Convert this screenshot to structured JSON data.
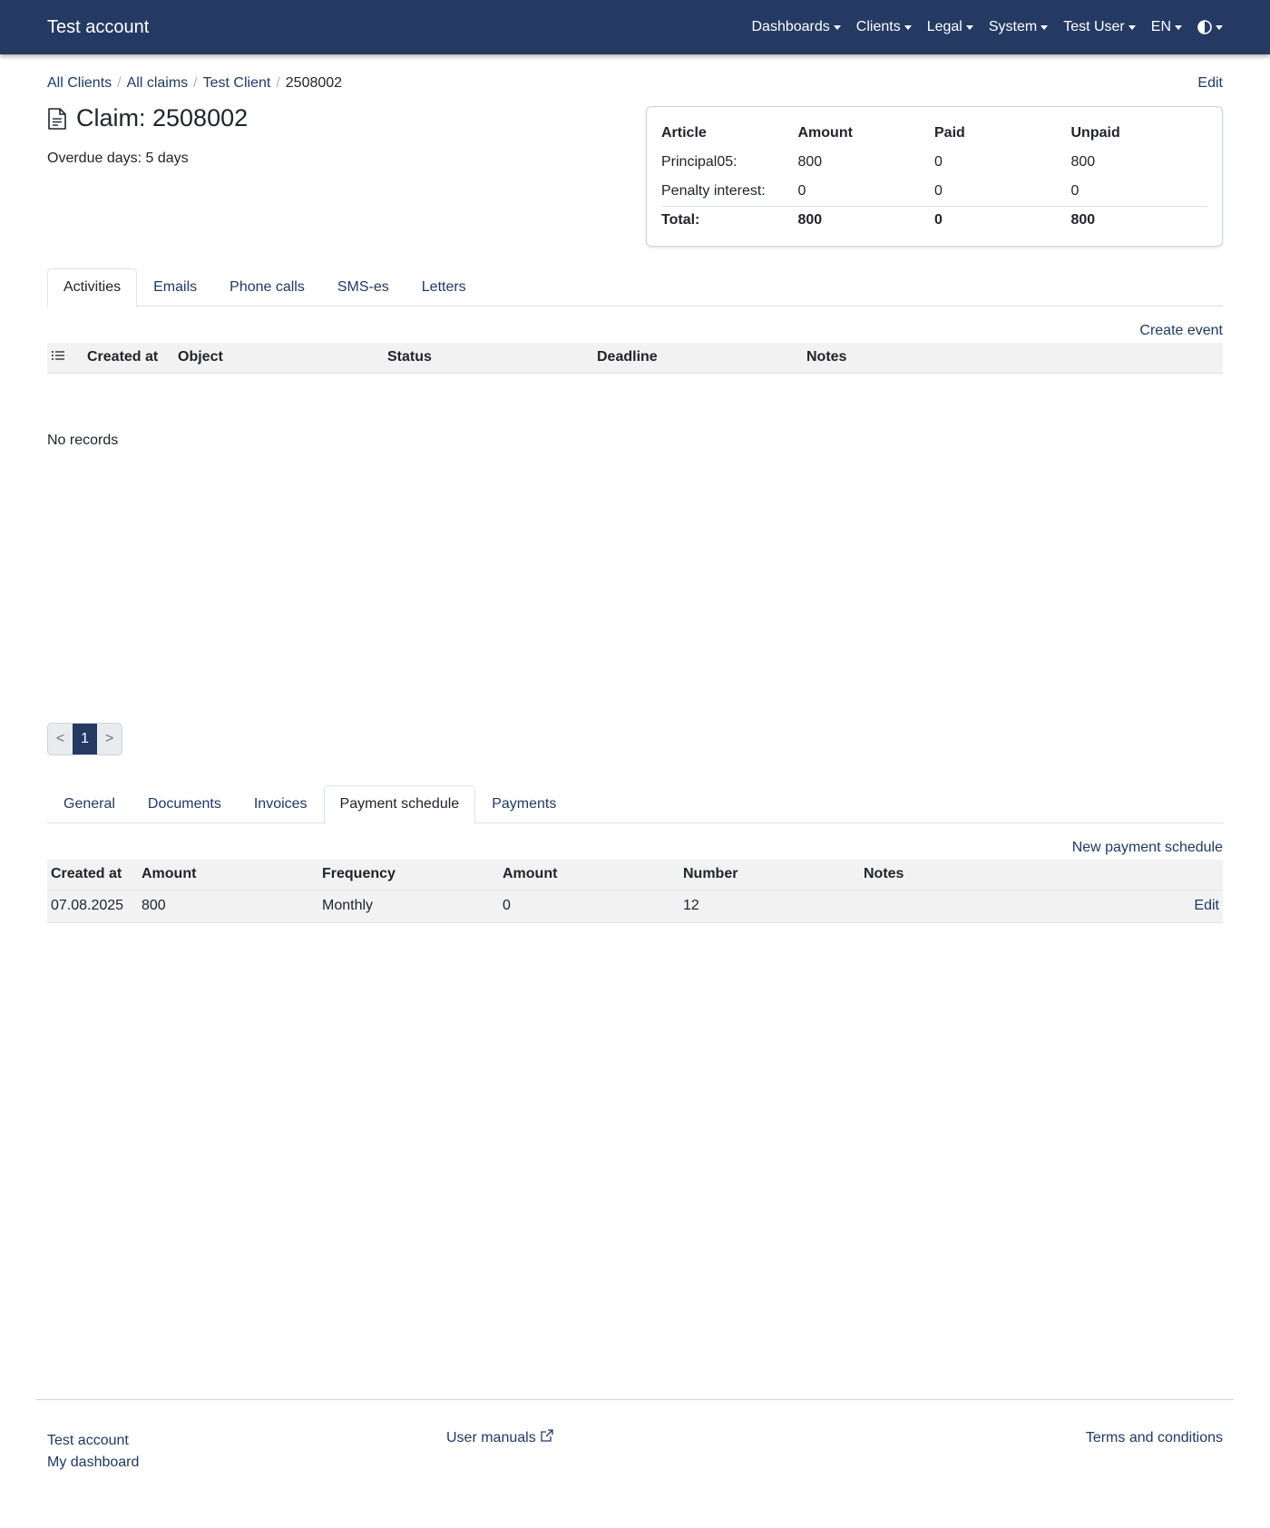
{
  "navbar": {
    "brand": "Test account",
    "items": [
      "Dashboards",
      "Clients",
      "Legal",
      "System",
      "Test User",
      "EN"
    ],
    "theme_icon": "half-circle-icon"
  },
  "breadcrumb": [
    "All Clients",
    "All claims",
    "Test Client",
    "2508002"
  ],
  "header": {
    "edit_label": "Edit",
    "title": "Claim: 2508002",
    "title_icon": "document-icon",
    "overdue": "Overdue days: 5 days"
  },
  "summary": {
    "headers": [
      "Article",
      "Amount",
      "Paid",
      "Unpaid"
    ],
    "rows": [
      [
        "Principal05:",
        "800",
        "0",
        "800"
      ],
      [
        "Penalty interest:",
        "0",
        "0",
        "0"
      ]
    ],
    "total": [
      "Total:",
      "800",
      "0",
      "800"
    ]
  },
  "activity_tabs": [
    "Activities",
    "Emails",
    "Phone calls",
    "SMS-es",
    "Letters"
  ],
  "activity_section": {
    "create_event": "Create event",
    "headers": [
      "Created at",
      "Object",
      "Status",
      "Deadline",
      "Notes"
    ],
    "list_icon": "list-icon",
    "empty": "No records"
  },
  "pagination": {
    "prev": "<",
    "page": "1",
    "next": ">"
  },
  "detail_tabs": [
    "General",
    "Documents",
    "Invoices",
    "Payment schedule",
    "Payments"
  ],
  "schedule": {
    "new_label": "New payment schedule",
    "headers": [
      "Created at",
      "Amount",
      "Frequency",
      "Amount",
      "Number",
      "Notes"
    ],
    "rows": [
      {
        "created_at": "07.08.2025",
        "amount": "800",
        "frequency": "Monthly",
        "amount2": "0",
        "number": "12",
        "notes": "",
        "edit": "Edit"
      }
    ]
  },
  "footer": {
    "test_account": "Test account",
    "my_dashboard": "My dashboard",
    "user_manuals": "User manuals",
    "terms": "Terms and conditions"
  }
}
